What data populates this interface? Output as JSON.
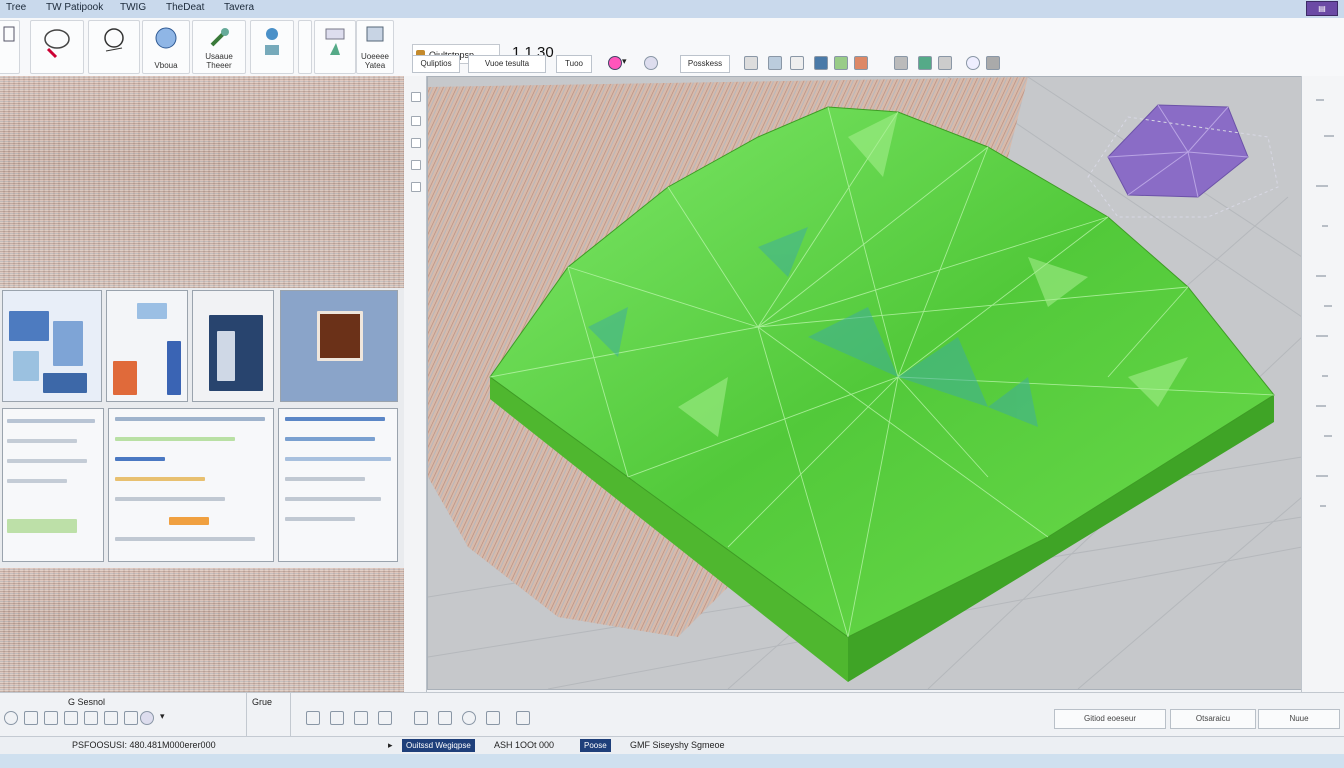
{
  "menu": {
    "items": [
      "Tree",
      "TW Patipook",
      "TWIG",
      "TheDeat",
      "Tavera"
    ]
  },
  "ribbon": {
    "buttons": [
      {
        "label": "",
        "icon": "pen-icon"
      },
      {
        "label": "",
        "icon": "brush-icon"
      },
      {
        "label": "",
        "icon": "pen-tool-icon"
      },
      {
        "label": "Vboua",
        "icon": "sphere-icon"
      },
      {
        "label": "Usaaue Theeer",
        "icon": "wrench-icon"
      },
      {
        "label": "",
        "icon": "gear-stack-icon"
      },
      {
        "label": "",
        "icon": "cursor-icon"
      },
      {
        "label": "Uoeeee Yatea",
        "icon": "building-icon"
      }
    ],
    "doc_title": "Qiultstppsp",
    "doc_dash": "–",
    "version": "1.1.30"
  },
  "subtoolbar": {
    "tabs": [
      "Quliptios",
      "Vuoe tesulta",
      "Tuoo",
      "Posskess"
    ],
    "icons": [
      "view-icon",
      "lens-icon",
      "grid-icon",
      "cube-icon",
      "frame-icon",
      "flag-icon",
      "layers-icon",
      "camera-icon",
      "brush-icon",
      "target-icon",
      "arrow-icon"
    ]
  },
  "left_panel": {
    "footer_label": "G Sesnol",
    "footer_icons": [
      "select-icon",
      "move-icon",
      "rotate-icon",
      "scale-icon",
      "paint-icon",
      "eye-icon",
      "dropdown-icon"
    ]
  },
  "bottom": {
    "label": "Grue",
    "tools": [
      "frame-icon",
      "axis-icon",
      "pencil-icon",
      "twig-icon",
      "brush-icon",
      "grid-icon",
      "rotate-icon",
      "arrow-icon"
    ],
    "right_buttons": [
      "Gitiod eoeseur",
      "Otsaraicu",
      "Nuue"
    ]
  },
  "status": {
    "coords": "PSFOOSUSI: 480.481M000erer000",
    "selection": "Ouitssd Wegiqpse",
    "value": "ASH 1OOt 000",
    "mode": "Poose",
    "info": "GMF Siseyshy Sgmeoe"
  },
  "colors": {
    "gem": "#5ed13a",
    "gem_dark": "#3f9f2a",
    "accent_blue": "#1e3f7a",
    "purple_gem": "#8a6cc6"
  }
}
